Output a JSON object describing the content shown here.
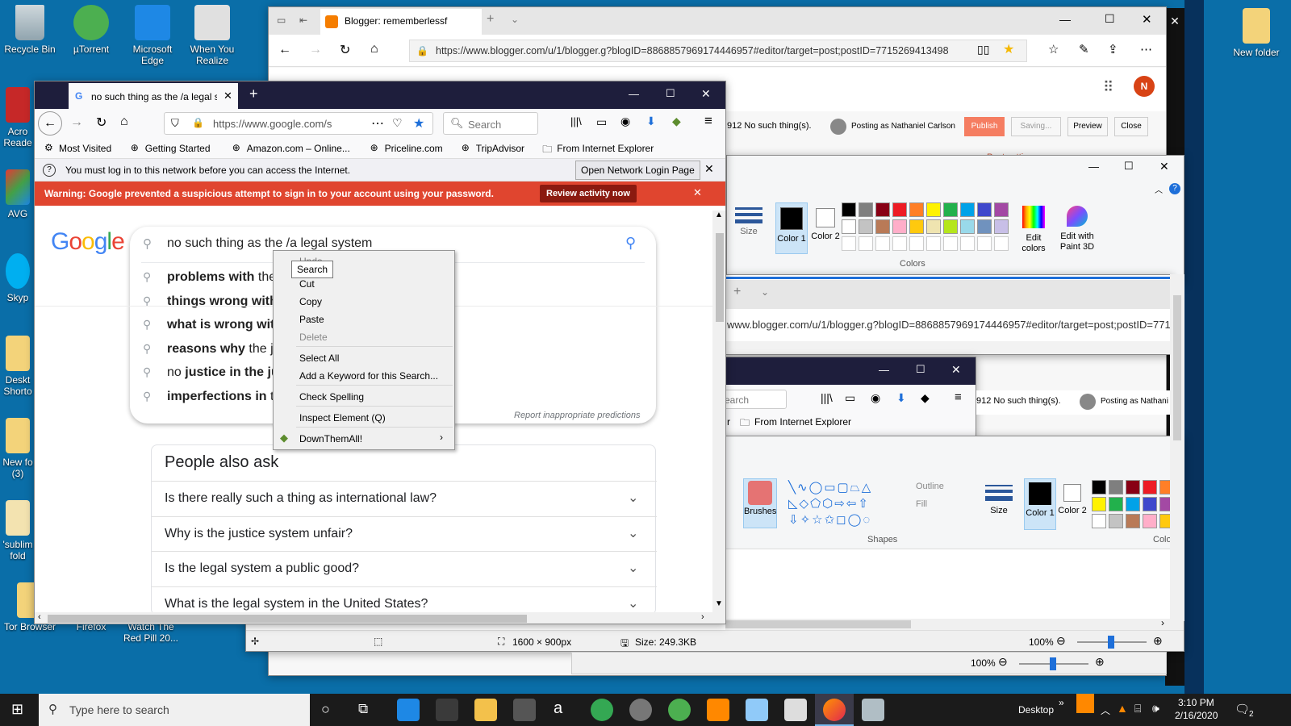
{
  "desktop": {
    "icons_left": [
      {
        "label": "Recycle Bin"
      },
      {
        "label": "Acro Reade"
      },
      {
        "label": "AVG"
      },
      {
        "label": "Skyp"
      },
      {
        "label": "Deskt Shorto"
      },
      {
        "label": "New fo (3)"
      },
      {
        "label": "'sublim fold"
      },
      {
        "label": "Tor Browser"
      }
    ],
    "icons_top": [
      {
        "label": "µTorrent"
      },
      {
        "label": "Microsoft Edge"
      },
      {
        "label": "When You Realize"
      }
    ],
    "icons_bottom": [
      {
        "label": "Firefox"
      },
      {
        "label": "Watch The Red Pill 20..."
      }
    ],
    "icon_right": {
      "label": "New folder"
    }
  },
  "edge": {
    "tab_title": "Blogger: rememberlessf",
    "url": "https://www.blogger.com/u/1/blogger.g?blogID=8868857969174446957#editor/target=post;postID=7715269413498",
    "avatar_letter": "N",
    "post_title_fragment": "912  No such thing(s).",
    "posting_as": "Posting as Nathaniel Carlson",
    "publish_label": "Publish",
    "saving_label": "Saving...",
    "preview_label": "Preview",
    "close_label": "Close",
    "post_settings": "Post settings",
    "zoom_label": "100%"
  },
  "paint": {
    "size_label": "Size",
    "color1_label": "Color 1",
    "color2_label": "Color 2",
    "colors_group": "Colors",
    "edit_colors_label": "Edit colors",
    "paint3d_label": "Edit with Paint 3D",
    "palette": [
      "#000000",
      "#7f7f7f",
      "#880015",
      "#ed1c24",
      "#ff7f27",
      "#fff200",
      "#22b14c",
      "#00a2e8",
      "#3f48cc",
      "#a349a4",
      "#ffffff",
      "#c3c3c3",
      "#b97a57",
      "#ffaec9",
      "#ffc90e",
      "#efe4b0",
      "#b5e61d",
      "#99d9ea",
      "#7092be",
      "#c8bfe7"
    ]
  },
  "paint2": {
    "brushes_label": "Brushes",
    "outline_label": "Outline",
    "fill_label": "Fill",
    "shapes_label": "Shapes",
    "size_label": "Size",
    "color1_label": "Color 1",
    "color2_label": "Color 2",
    "colors_label": "Color",
    "dimensions": "1600 × 900px",
    "filesize": "Size: 249.3KB",
    "zoom": "100%"
  },
  "inner_edge": {
    "url": "www.blogger.com/u/1/blogger.g?blogID=8868857969174446957#editor/target=post;postID=7715",
    "search_placeholder": "earch",
    "from_ie": "From Internet Explorer",
    "post_title_fragment": "912  No such thing(s).",
    "posting_as": "Posting as Nathani"
  },
  "firefox": {
    "tab_title": "no such thing as the /a legal sy",
    "url": "https://www.google.com/s",
    "search_placeholder": "Search",
    "bookmarks": [
      "Most Visited",
      "Getting Started",
      "Amazon.com – Online...",
      "Priceline.com",
      "TripAdvisor",
      "From Internet Explorer"
    ],
    "network_notice": "You must log in to this network before you can access the Internet.",
    "network_button": "Open Network Login Page",
    "warning": "Warning: Google prevented a suspicious attempt to sign in to your account using your password.",
    "warning_button": "Review activity now"
  },
  "google": {
    "logo": "Google",
    "query": "no such thing as the /a legal system",
    "suggestions": [
      {
        "bold": "problems with",
        "rest": " the"
      },
      {
        "bold": "things wrong with",
        "rest": ""
      },
      {
        "bold": "what is wrong wit",
        "rest": ""
      },
      {
        "bold": "reasons why",
        "rest": " the j"
      },
      {
        "bold": "justice in the ju",
        "rest": "",
        "prefix": "no "
      },
      {
        "bold": "imperfections in",
        "rest": " t"
      }
    ],
    "report_link": "Report inappropriate predictions",
    "paa_title": "People also ask",
    "paa": [
      "Is there really such a thing as international law?",
      "Why is the justice system unfair?",
      "Is the legal system a public good?",
      "What is the legal system in the United States?"
    ]
  },
  "context_menu": {
    "tooltip": "Search",
    "undo": "Undo",
    "items": [
      "Cut",
      "Copy",
      "Paste",
      "Delete",
      "Select All",
      "Add a Keyword for this Search...",
      "Check Spelling",
      "Inspect Element (Q)",
      "DownThemAll!"
    ]
  },
  "taskbar": {
    "search_placeholder": "Type here to search",
    "desktop_label": "Desktop",
    "time": "3:10 PM",
    "date": "2/16/2020",
    "notifications": "2"
  }
}
